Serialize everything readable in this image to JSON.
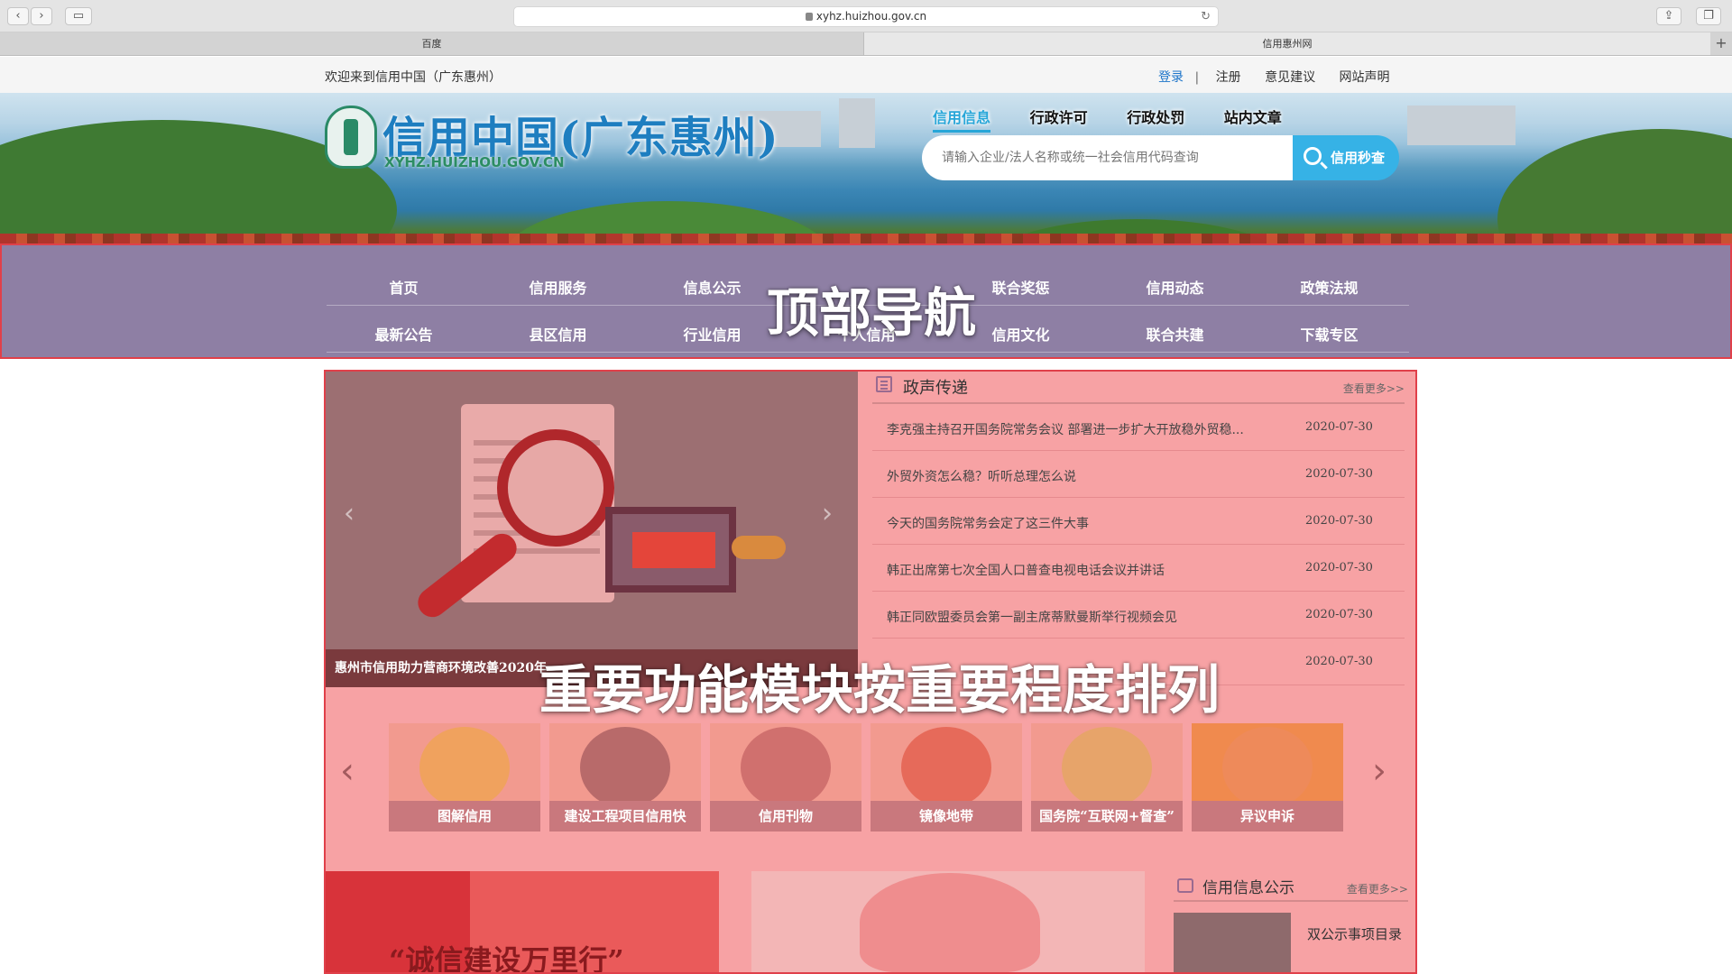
{
  "browser": {
    "url": "xyhz.huizhou.gov.cn",
    "tabs": [
      "百度",
      "信用惠州网"
    ],
    "new_tab": "+"
  },
  "topbar": {
    "welcome": "欢迎来到信用中国（广东惠州）",
    "links": {
      "login": "登录",
      "sep": "|",
      "register": "注册",
      "feedback": "意见建议",
      "statement": "网站声明"
    }
  },
  "header": {
    "logo_title": "信用中国(广东惠州)",
    "logo_sub": "XYHZ.HUIZHOU.GOV.CN",
    "search_tabs": [
      "信用信息",
      "行政许可",
      "行政处罚",
      "站内文章"
    ],
    "search_placeholder": "请输入企业/法人名称或统一社会信用代码查询",
    "search_button": "信用秒查"
  },
  "nav": {
    "row1": [
      "首页",
      "信用服务",
      "信息公示",
      "",
      "联合奖惩",
      "信用动态",
      "政策法规"
    ],
    "row2": [
      "最新公告",
      "县区信用",
      "行业信用",
      "个人信用",
      "信用文化",
      "联合共建",
      "下载专区"
    ],
    "overlay_label": "顶部导航"
  },
  "slider": {
    "caption": "惠州市信用助力营商环境改善2020年",
    "prev": "‹",
    "next": "›"
  },
  "news": {
    "title": "政声传递",
    "more": "查看更多>>",
    "items": [
      {
        "title": "李克强主持召开国务院常务会议 部署进一步扩大开放稳外贸稳...",
        "date": "2020-07-30"
      },
      {
        "title": "外贸外资怎么稳？听听总理怎么说",
        "date": "2020-07-30"
      },
      {
        "title": "今天的国务院常务会定了这三件大事",
        "date": "2020-07-30"
      },
      {
        "title": "韩正出席第七次全国人口普查电视电话会议并讲话",
        "date": "2020-07-30"
      },
      {
        "title": "韩正同欧盟委员会第一副主席蒂默曼斯举行视频会见",
        "date": "2020-07-30"
      },
      {
        "title": "",
        "date": "2020-07-30"
      }
    ]
  },
  "overlay_main": "重要功能模块按重要程度排列",
  "functions": {
    "prev": "‹",
    "next": "›",
    "items": [
      {
        "label": "图解信用",
        "color": "#f0a25e"
      },
      {
        "label": "建设工程项目信用快",
        "color": "#b86a6a"
      },
      {
        "label": "信用刊物",
        "color": "#d0706e"
      },
      {
        "label": "镜像地带",
        "color": "#e66a5a"
      },
      {
        "label": "国务院“互联网+督查”",
        "color": "#e7a46a"
      },
      {
        "label": "异议申诉",
        "color": "#ee8a5a"
      }
    ]
  },
  "bottom": {
    "left_slogan": "“诚信建设万里行”",
    "right_title": "信用信息公示",
    "right_more": "查看更多>>",
    "right_item": "双公示事项目录"
  }
}
